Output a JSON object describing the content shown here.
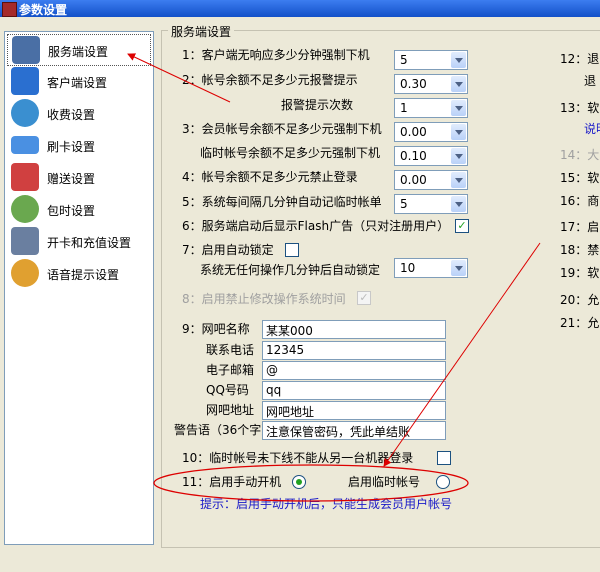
{
  "window": {
    "title": "参数设置"
  },
  "sidebar": {
    "items": [
      {
        "label": "服务端设置",
        "icon": "server-icon",
        "color": "#4a6fa5"
      },
      {
        "label": "客户端设置",
        "icon": "monitor-icon",
        "color": "#2a6fd0"
      },
      {
        "label": "收费设置",
        "icon": "clock-icon",
        "color": "#3a8fd0"
      },
      {
        "label": "刷卡设置",
        "icon": "card-icon",
        "color": "#4a90e2"
      },
      {
        "label": "赠送设置",
        "icon": "gift-icon",
        "color": "#d04040"
      },
      {
        "label": "包时设置",
        "icon": "timer-icon",
        "color": "#6aa84f"
      },
      {
        "label": "开卡和充值设置",
        "icon": "user-icon",
        "color": "#6a7fa0"
      },
      {
        "label": "语音提示设置",
        "icon": "microphone-icon",
        "color": "#e0a030"
      }
    ]
  },
  "group": {
    "title": "服务端设置"
  },
  "settings": {
    "s1": {
      "label": "1：客户端无响应多少分钟强制下机",
      "value": "5"
    },
    "s2": {
      "label": "2：帐号余额不足多少元报警提示",
      "value": "0.30"
    },
    "s2b": {
      "label": "报警提示次数",
      "value": "1"
    },
    "s3": {
      "label": "3：会员帐号余额不足多少元强制下机",
      "value": "0.00"
    },
    "s3b": {
      "label": "临时帐号余额不足多少元强制下机",
      "value": "0.10"
    },
    "s4": {
      "label": "4：帐号余额不足多少元禁止登录",
      "value": "0.00"
    },
    "s5": {
      "label": "5：系统每间隔几分钟自动记临时帐单",
      "value": "5"
    },
    "s6": {
      "label": "6：服务端启动后显示Flash广告（只对注册用户）",
      "checked": "✓"
    },
    "s7": {
      "label": "7：启用自动锁定"
    },
    "s7b": {
      "label": "系统无任何操作几分钟后自动锁定",
      "value": "10"
    },
    "s8": {
      "label": "8：启用禁止修改操作系统时间",
      "checked": "✓"
    },
    "s9": {
      "label": "9：网吧名称",
      "name": "某某000",
      "phone_label": "联系电话",
      "phone": "12345",
      "email_label": "电子邮箱",
      "email": "@",
      "qq_label": "QQ号码",
      "qq": "qq",
      "url_label": "网吧地址",
      "url": "网吧地址",
      "warn_label": "警告语（36个字）",
      "warn": "注意保管密码，凭此单结账"
    },
    "s10": {
      "label": "10：临时帐号未下线不能从另一台机器登录"
    },
    "s11": {
      "label": "11：启用手动开机",
      "alt_label": "启用临时帐号",
      "hint": "提示：启用手动开机后，只能生成会员用户帐号"
    }
  },
  "right_column": [
    {
      "text": "12：退"
    },
    {
      "text": "退"
    },
    {
      "text": "13：软"
    },
    {
      "text": "说明"
    },
    {
      "text": "14：大",
      "disabled": true
    },
    {
      "text": "15：软"
    },
    {
      "text": "16：商"
    },
    {
      "text": "17：启"
    },
    {
      "text": "18：禁"
    },
    {
      "text": "19：软"
    },
    {
      "text": "20：允"
    },
    {
      "text": "21：允"
    }
  ]
}
